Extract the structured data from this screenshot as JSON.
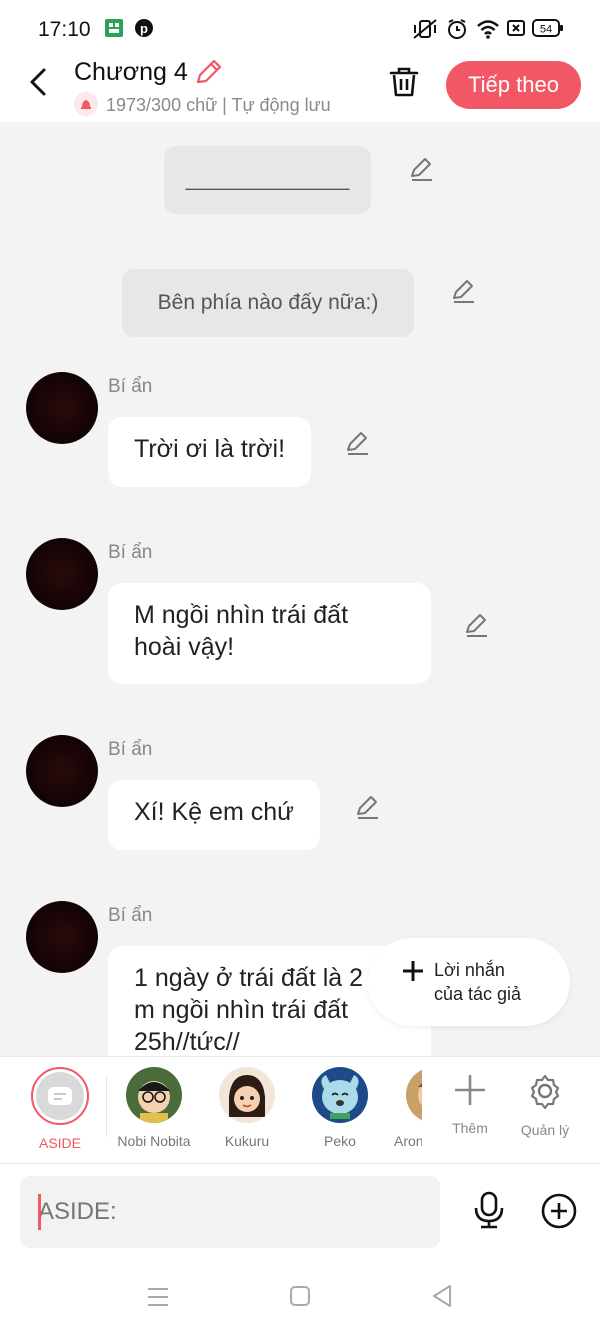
{
  "status": {
    "time": "17:10",
    "battery": "54"
  },
  "header": {
    "title": "Chương 4",
    "subtitle": "1973/300 chữ | Tự động lưu",
    "next_label": "Tiếp theo"
  },
  "messages": {
    "narr1": "______________",
    "narr2": "Bên phía nào đấy nữa:)",
    "m1": {
      "name": "Bí ẩn",
      "line1": "Trời ơi là trời!"
    },
    "m2": {
      "name": "Bí ẩn",
      "line1": "M ngồi nhìn trái đất",
      "line2": "hoài vậy!"
    },
    "m3": {
      "name": "Bí ẩn",
      "line1": "Xí! Kệ em chứ"
    },
    "m4": {
      "name": "Bí ẩn",
      "line1": "1 ngày ở trái đất là 2",
      "line2": "m ngồi nhìn trái đất",
      "line3": "25h//tức//"
    }
  },
  "author_note": {
    "line1": "Lời nhắn",
    "line2": "của tác giả"
  },
  "characters": [
    {
      "label": "ASIDE"
    },
    {
      "label": "Nobi Nobita"
    },
    {
      "label": "Kukuru"
    },
    {
      "label": "Peko"
    },
    {
      "label": "Aron"
    }
  ],
  "tools": {
    "more": "Thêm",
    "manage": "Quản lý"
  },
  "input": {
    "placeholder": "ASIDE:"
  },
  "colors": {
    "accent": "#f25766",
    "chat_bg": "#f3f3f3"
  }
}
